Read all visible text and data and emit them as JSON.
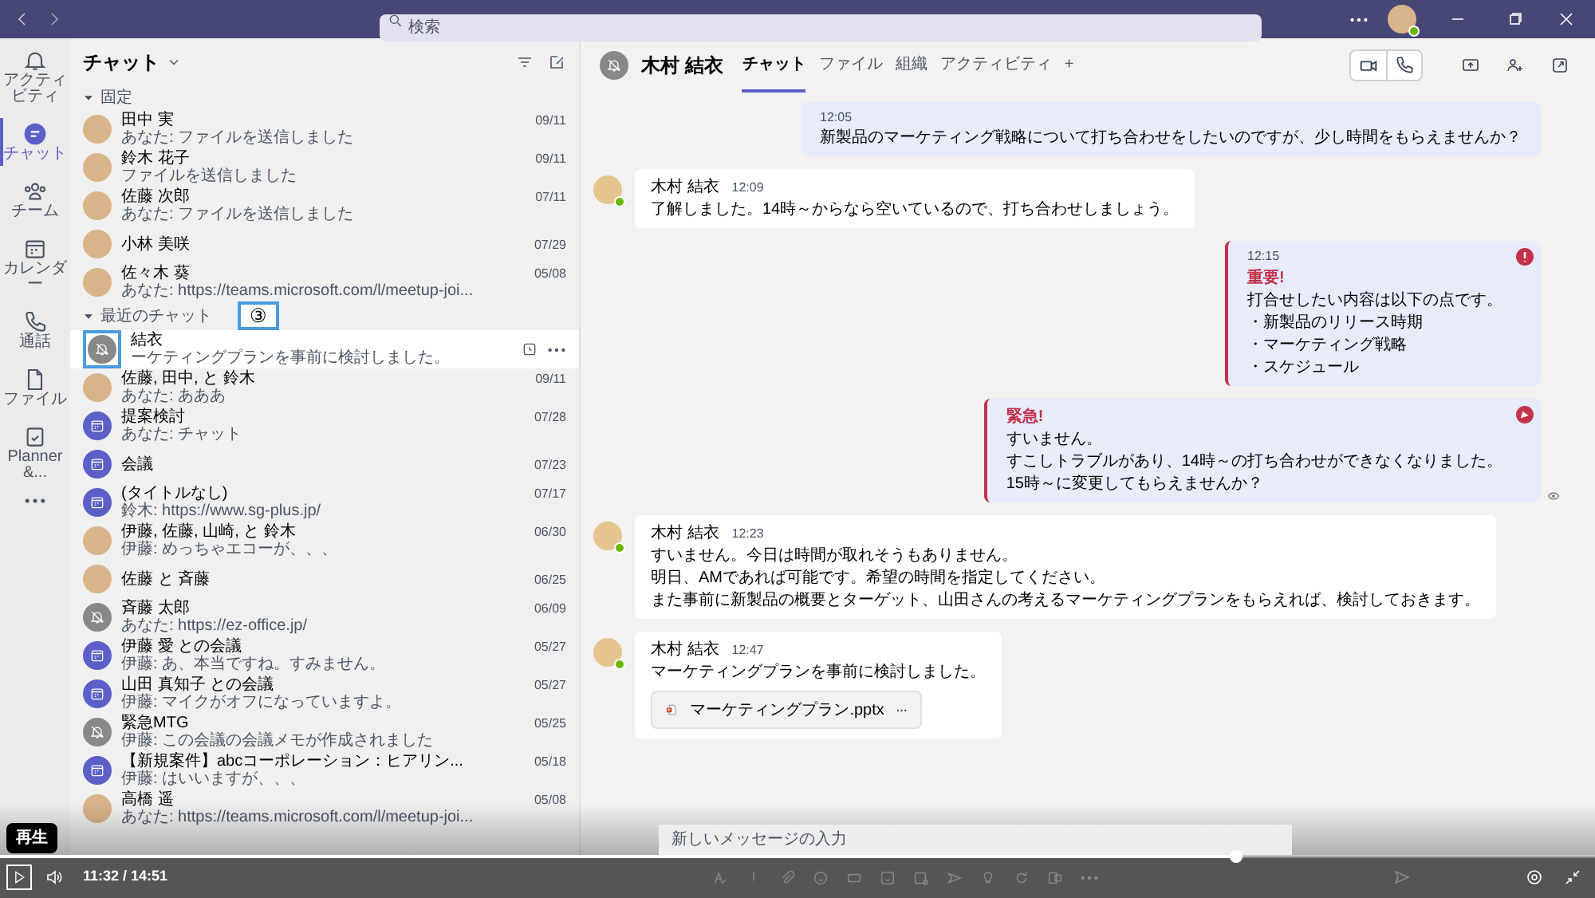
{
  "search": {
    "placeholder": "検索"
  },
  "rail": [
    {
      "label": "アクティビティ",
      "kind": "bell",
      "selected": false
    },
    {
      "label": "チャット",
      "kind": "chat",
      "selected": true
    },
    {
      "label": "チーム",
      "kind": "team",
      "selected": false
    },
    {
      "label": "カレンダー",
      "kind": "calendar",
      "selected": false
    },
    {
      "label": "通話",
      "kind": "phone",
      "selected": false
    },
    {
      "label": "ファイル",
      "kind": "file",
      "selected": false
    },
    {
      "label": "Planner &...",
      "kind": "planner",
      "selected": false
    },
    {
      "kind": "more",
      "selected": false
    }
  ],
  "chat_list": {
    "title": "チャット",
    "sections": [
      {
        "label": "固定",
        "items": [
          {
            "name": "田中 実",
            "preview": "あなた: ファイルを送信しました",
            "date": "09/11",
            "kind": "person",
            "selected": false
          },
          {
            "name": "鈴木 花子",
            "preview": "ファイルを送信しました",
            "date": "09/11",
            "kind": "person",
            "selected": false
          },
          {
            "name": "佐藤 次郎",
            "preview": "あなた: ファイルを送信しました",
            "date": "07/11",
            "kind": "person",
            "selected": false
          },
          {
            "name": "小林 美咲",
            "date": "07/29",
            "kind": "person",
            "selected": false
          },
          {
            "name": "佐々木 葵",
            "preview": "あなた: https://teams.microsoft.com/l/meetup-joi...",
            "date": "05/08",
            "kind": "person",
            "selected": false
          }
        ]
      },
      {
        "label": "最近のチャット",
        "items": [
          {
            "name": "結衣",
            "preview": "ーケティングプランを事前に検討しました。",
            "kind": "muted",
            "selected": true
          },
          {
            "name": "佐藤, 田中, と 鈴木",
            "preview": "あなた: あああ",
            "date": "09/11",
            "kind": "person",
            "selected": false
          },
          {
            "name": "提案検討",
            "preview": "あなた: チャット",
            "date": "07/28",
            "kind": "meeting",
            "selected": false
          },
          {
            "name": "会議",
            "date": "07/23",
            "kind": "meeting",
            "selected": false
          },
          {
            "name": "(タイトルなし)",
            "preview": "鈴木: https://www.sg-plus.jp/",
            "date": "07/17",
            "kind": "meeting",
            "selected": false
          },
          {
            "name": "伊藤, 佐藤, 山崎, と 鈴木",
            "preview": "伊藤: めっちゃエコーが、、、",
            "date": "06/30",
            "kind": "person",
            "selected": false
          },
          {
            "name": "佐藤 と 斉藤",
            "date": "06/25",
            "kind": "person",
            "selected": false
          },
          {
            "name": "斉藤 太郎",
            "preview": "あなた: https://ez-office.jp/",
            "date": "06/09",
            "kind": "muted",
            "selected": false
          },
          {
            "name": "伊藤 愛 との会議",
            "preview": "伊藤: あ、本当ですね。すみません。",
            "date": "05/27",
            "kind": "meeting",
            "selected": false
          },
          {
            "name": "山田 真知子 との会議",
            "preview": "伊藤: マイクがオフになっていますよ。",
            "date": "05/27",
            "kind": "meeting",
            "selected": false
          },
          {
            "name": "緊急MTG",
            "preview": "伊藤: この会議の会議メモが作成されました",
            "date": "05/25",
            "kind": "muted",
            "selected": false
          },
          {
            "name": "【新規案件】abcコーポレーション：ヒアリン...",
            "preview": "伊藤: はいいますが、、、",
            "date": "05/18",
            "kind": "meeting",
            "selected": false
          },
          {
            "name": "高橋 遥",
            "preview": "あなた: https://teams.microsoft.com/l/meetup-joi...",
            "date": "05/08",
            "kind": "person",
            "selected": false
          }
        ]
      }
    ]
  },
  "callout": {
    "label": "③"
  },
  "conversation": {
    "title": "木村 結衣",
    "tabs": [
      {
        "label": "チャット",
        "selected": true
      },
      {
        "label": "ファイル",
        "selected": false
      },
      {
        "label": "組織",
        "selected": false
      },
      {
        "label": "アクティビティ",
        "selected": false
      },
      {
        "label": "+",
        "selected": false
      }
    ],
    "messages": [
      {
        "kind": "sent",
        "time": "12:05",
        "lines": [
          "新製品のマーケティング戦略について打ち合わせをしたいのですが、少し時間をもらえませんか？"
        ]
      },
      {
        "kind": "received",
        "author": "木村 結衣",
        "time": "12:09",
        "lines": [
          "了解しました。14時～からなら空いているので、打ち合わせしましょう。"
        ]
      },
      {
        "kind": "important",
        "time": "12:15",
        "flag": "重要!",
        "lines": [
          "打合せしたい内容は以下の点です。",
          "・新製品のリリース時期",
          "・マーケティング戦略",
          "・スケジュール"
        ]
      },
      {
        "kind": "urgent",
        "flag": "緊急!",
        "lines": [
          "すいません。",
          "すこしトラブルがあり、14時～の打ち合わせができなくなりました。",
          "15時～に変更してもらえませんか？"
        ]
      },
      {
        "kind": "received",
        "author": "木村 結衣",
        "time": "12:23",
        "lines": [
          "すいません。今日は時間が取れそうもありません。",
          "明日、AMであれば可能です。希望の時間を指定してください。",
          "また事前に新製品の概要とターゲット、山田さんの考えるマーケティングプランをもらえれば、検討しておきます。"
        ]
      },
      {
        "kind": "received",
        "author": "木村 結衣",
        "time": "12:47",
        "lines": [
          "マーケティングプランを事前に検討しました。"
        ],
        "attachment": "マーケティングプラン.pptx"
      }
    ]
  },
  "composer": {
    "placeholder": "新しいメッセージの入力"
  },
  "player": {
    "tooltip": "再生",
    "time": "11:32 / 14:51",
    "level": 0.775
  }
}
